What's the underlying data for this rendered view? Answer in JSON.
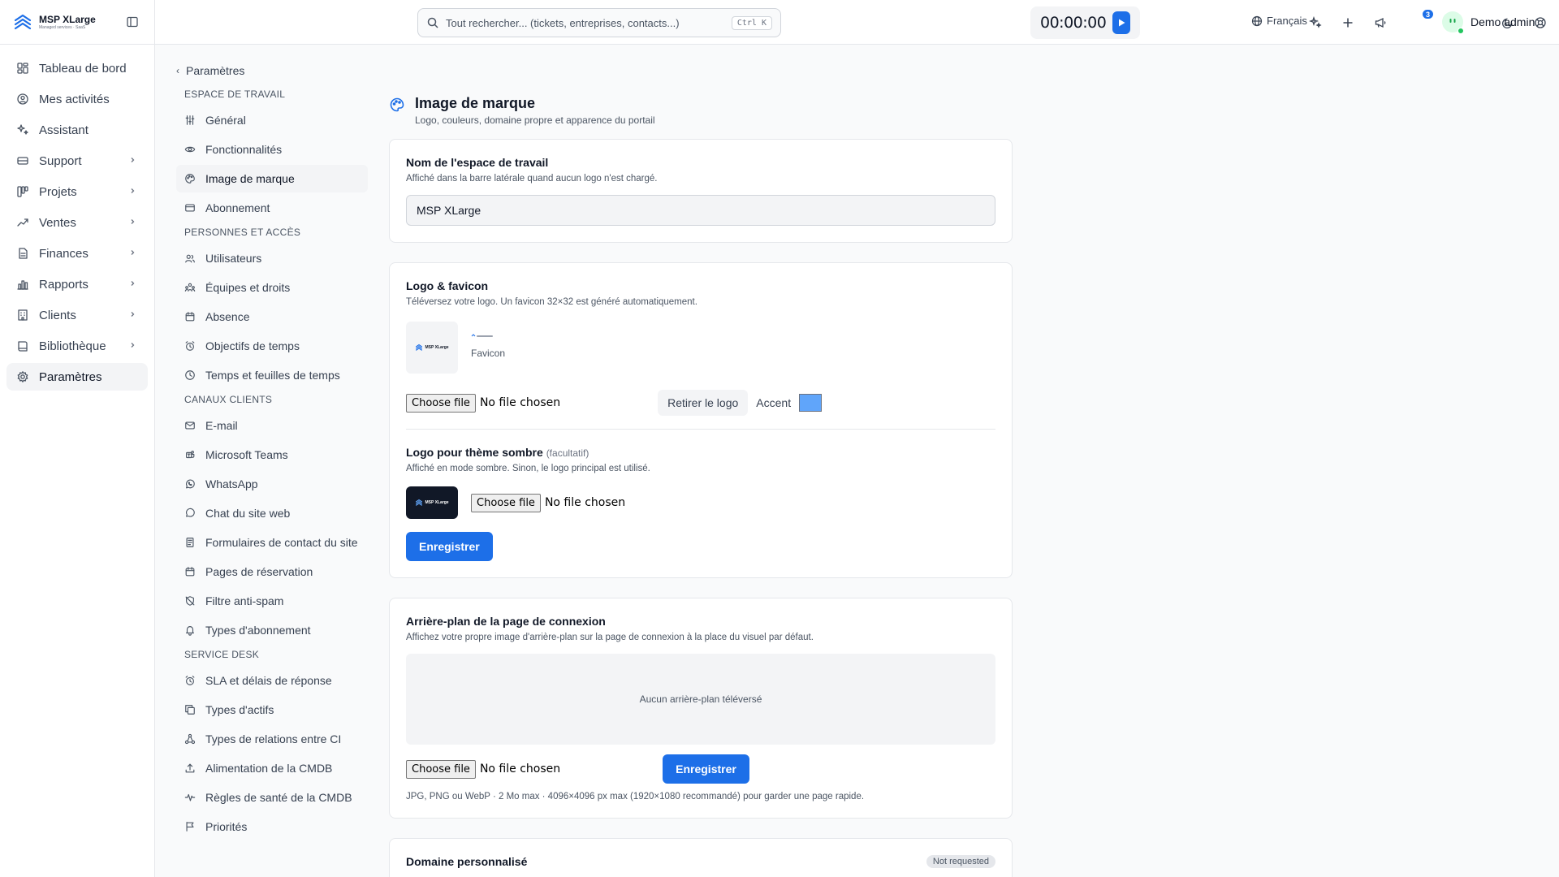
{
  "brand": {
    "name": "MSP XLarge",
    "tagline": "Managed services · SaaS"
  },
  "sidebar": {
    "items": [
      {
        "label": "Tableau de bord",
        "icon": "dashboard-icon",
        "chevron": false
      },
      {
        "label": "Mes activités",
        "icon": "user-circle-icon",
        "chevron": false
      },
      {
        "label": "Assistant",
        "icon": "sparkles-icon",
        "chevron": false
      },
      {
        "label": "Support",
        "icon": "support-icon",
        "chevron": true
      },
      {
        "label": "Projets",
        "icon": "projects-icon",
        "chevron": true
      },
      {
        "label": "Ventes",
        "icon": "trend-icon",
        "chevron": true
      },
      {
        "label": "Finances",
        "icon": "document-icon",
        "chevron": true
      },
      {
        "label": "Rapports",
        "icon": "bar-chart-icon",
        "chevron": true
      },
      {
        "label": "Clients",
        "icon": "building-icon",
        "chevron": true
      },
      {
        "label": "Bibliothèque",
        "icon": "book-icon",
        "chevron": true
      },
      {
        "label": "Paramètres",
        "icon": "gear-icon",
        "chevron": false,
        "active": true
      }
    ]
  },
  "topbar": {
    "search_placeholder": "Tout rechercher... (tickets, entreprises, contacts...)",
    "search_shortcut": "Ctrl K",
    "timer": "00:00:00",
    "language": "Français",
    "notifications_count": "3",
    "user_name": "Demo admin"
  },
  "subnav": {
    "back_label": "Paramètres",
    "sections": [
      {
        "label": "ESPACE DE TRAVAIL",
        "items": [
          {
            "label": "Général",
            "icon": "sliders-icon"
          },
          {
            "label": "Fonctionnalités",
            "icon": "eye-icon"
          },
          {
            "label": "Image de marque",
            "icon": "palette-icon",
            "active": true
          },
          {
            "label": "Abonnement",
            "icon": "credit-card-icon"
          }
        ]
      },
      {
        "label": "PERSONNES ET ACCÈS",
        "items": [
          {
            "label": "Utilisateurs",
            "icon": "users-icon"
          },
          {
            "label": "Équipes et droits",
            "icon": "team-icon"
          },
          {
            "label": "Absence",
            "icon": "calendar-icon"
          },
          {
            "label": "Objectifs de temps",
            "icon": "alarm-icon"
          },
          {
            "label": "Temps et feuilles de temps",
            "icon": "clock-icon"
          }
        ]
      },
      {
        "label": "CANAUX CLIENTS",
        "items": [
          {
            "label": "E-mail",
            "icon": "mail-icon"
          },
          {
            "label": "Microsoft Teams",
            "icon": "teams-icon"
          },
          {
            "label": "WhatsApp",
            "icon": "whatsapp-icon"
          },
          {
            "label": "Chat du site web",
            "icon": "chat-icon"
          },
          {
            "label": "Formulaires de contact du site",
            "icon": "form-icon"
          },
          {
            "label": "Pages de réservation",
            "icon": "calendar-icon"
          },
          {
            "label": "Filtre anti-spam",
            "icon": "shield-off-icon"
          },
          {
            "label": "Types d'abonnement",
            "icon": "bell-icon"
          }
        ]
      },
      {
        "label": "SERVICE DESK",
        "items": [
          {
            "label": "SLA et délais de réponse",
            "icon": "alarm-icon"
          },
          {
            "label": "Types d'actifs",
            "icon": "copy-icon"
          },
          {
            "label": "Types de relations entre CI",
            "icon": "network-icon"
          },
          {
            "label": "Alimentation de la CMDB",
            "icon": "upload-icon"
          },
          {
            "label": "Règles de santé de la CMDB",
            "icon": "pulse-icon"
          },
          {
            "label": "Priorités",
            "icon": "flag-icon"
          }
        ]
      }
    ]
  },
  "page": {
    "title": "Image de marque",
    "subtitle": "Logo, couleurs, domaine propre et apparence du portail",
    "workspace_card": {
      "title": "Nom de l'espace de travail",
      "subtitle": "Affiché dans la barre latérale quand aucun logo n'est chargé.",
      "value": "MSP XLarge"
    },
    "logo_card": {
      "title": "Logo & favicon",
      "subtitle": "Téléversez votre logo. Un favicon 32×32 est généré automatiquement.",
      "logo_text": "MSP XLarge",
      "favicon_label": "Favicon",
      "file_button": "Choose file",
      "file_status": "No file chosen",
      "remove_button": "Retirer le logo",
      "accent_label": "Accent",
      "accent_color": "#60a5fa",
      "dark_title": "Logo pour thème sombre",
      "dark_optional": "(facultatif)",
      "dark_subtitle": "Affiché en mode sombre. Sinon, le logo principal est utilisé.",
      "save_button": "Enregistrer"
    },
    "background_card": {
      "title": "Arrière-plan de la page de connexion",
      "subtitle": "Affichez votre propre image d'arrière-plan sur la page de connexion à la place du visuel par défaut.",
      "empty": "Aucun arrière-plan téléversé",
      "file_button": "Choose file",
      "file_status": "No file chosen",
      "save_button": "Enregistrer",
      "hint": "JPG, PNG ou WebP · 2 Mo max · 4096×4096 px max (1920×1080 recommandé) pour garder une page rapide."
    },
    "domain_card": {
      "title": "Domaine personnalisé",
      "status": "Not requested"
    }
  },
  "colors": {
    "primary": "#1d6fe8",
    "accent": "#60a5fa"
  }
}
